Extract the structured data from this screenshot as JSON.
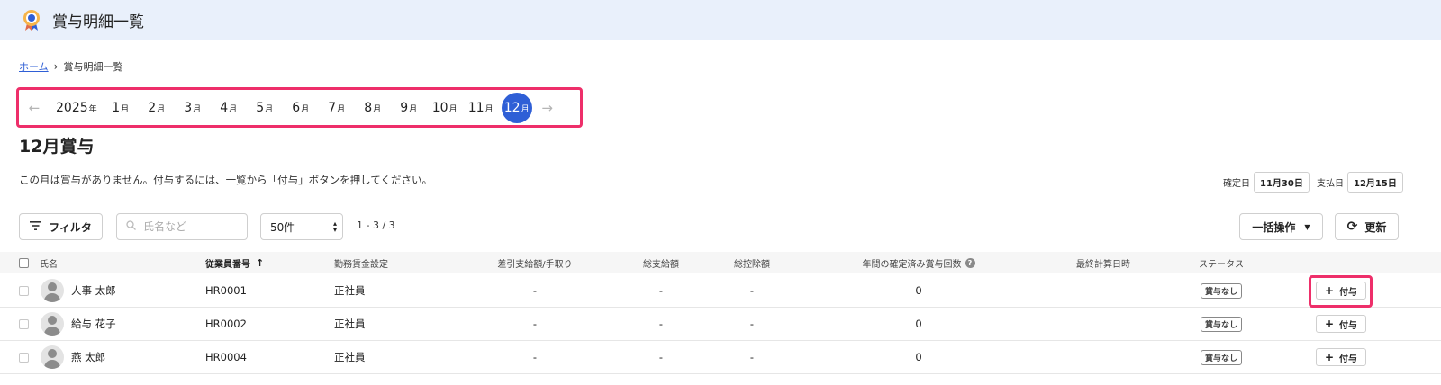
{
  "header": {
    "title": "賞与明細一覧",
    "logo_icon": "badge-logo-icon"
  },
  "breadcrumb": {
    "home": "ホーム",
    "current": "賞与明細一覧"
  },
  "month_nav": {
    "year": "2025",
    "year_suffix": "年",
    "month_suffix": "月",
    "months": [
      "1",
      "2",
      "3",
      "4",
      "5",
      "6",
      "7",
      "8",
      "9",
      "10",
      "11",
      "12"
    ],
    "selected": "12",
    "prev_icon": "arrow-left-icon",
    "next_icon": "arrow-right-icon"
  },
  "page": {
    "heading": "12月賞与",
    "notice": "この月は賞与がありません。付与するには、一覧から「付与」ボタンを押してください。",
    "confirm_label": "確定日",
    "confirm_date": "11月30日",
    "pay_label": "支払日",
    "pay_date": "12月15日"
  },
  "toolbar": {
    "filter_label": "フィルタ",
    "search_placeholder": "氏名など",
    "per_page": "50件",
    "count": "1 - 3 / 3",
    "bulk_label": "一括操作",
    "refresh_label": "更新"
  },
  "table": {
    "columns": {
      "name": "氏名",
      "employee_no": "従業員番号",
      "wage_setting": "勤務賃金設定",
      "net_pay": "差引支給額/手取り",
      "gross": "総支給額",
      "deduction": "総控除額",
      "confirmed_count": "年間の確定済み賞与回数",
      "last_calc": "最終計算日時",
      "status": "ステータス"
    },
    "rows": [
      {
        "name": "人事 太郎",
        "employee_no": "HR0001",
        "wage_setting": "正社員",
        "net_pay": "-",
        "gross": "-",
        "deduction": "-",
        "confirmed_count": "0",
        "last_calc": "",
        "status": "賞与なし",
        "action": "付与"
      },
      {
        "name": "給与 花子",
        "employee_no": "HR0002",
        "wage_setting": "正社員",
        "net_pay": "-",
        "gross": "-",
        "deduction": "-",
        "confirmed_count": "0",
        "last_calc": "",
        "status": "賞与なし",
        "action": "付与"
      },
      {
        "name": "燕 太郎",
        "employee_no": "HR0004",
        "wage_setting": "正社員",
        "net_pay": "-",
        "gross": "-",
        "deduction": "-",
        "confirmed_count": "0",
        "last_calc": "",
        "status": "賞与なし",
        "action": "付与"
      }
    ]
  },
  "colors": {
    "accent": "#2f5fd6",
    "highlight": "#ee2f6a",
    "topbar": "#e9f0fb"
  }
}
